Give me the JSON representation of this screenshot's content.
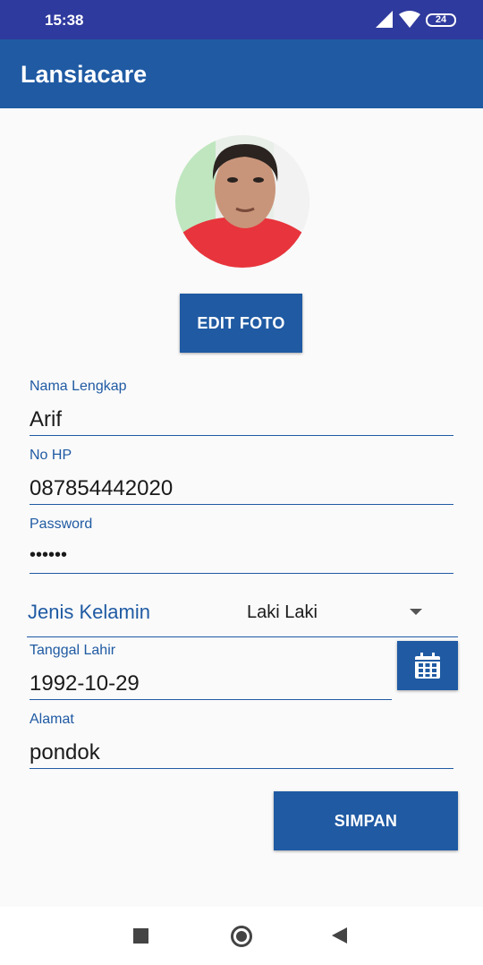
{
  "status_bar": {
    "time": "15:38",
    "battery": "24"
  },
  "app_bar": {
    "title": "Lansiacare"
  },
  "profile": {
    "edit_photo_label": "EDIT FOTO"
  },
  "form": {
    "name": {
      "label": "Nama Lengkap",
      "value": "Arif"
    },
    "phone": {
      "label": "No HP",
      "value": "087854442020"
    },
    "password": {
      "label": "Password",
      "value": "••••••"
    },
    "gender": {
      "label": "Jenis Kelamin",
      "value": "Laki Laki"
    },
    "birth_date": {
      "label": "Tanggal Lahir",
      "value": "1992-10-29"
    },
    "address": {
      "label": "Alamat",
      "value": "pondok"
    }
  },
  "actions": {
    "save_label": "SIMPAN"
  },
  "colors": {
    "primary": "#1f5aa3",
    "status_bar": "#2f3a9e",
    "background": "#fafafa"
  },
  "icons": [
    "signal-icon",
    "wifi-icon",
    "battery-icon",
    "calendar-icon",
    "dropdown-arrow-icon",
    "nav-recents-icon",
    "nav-home-icon",
    "nav-back-icon"
  ]
}
